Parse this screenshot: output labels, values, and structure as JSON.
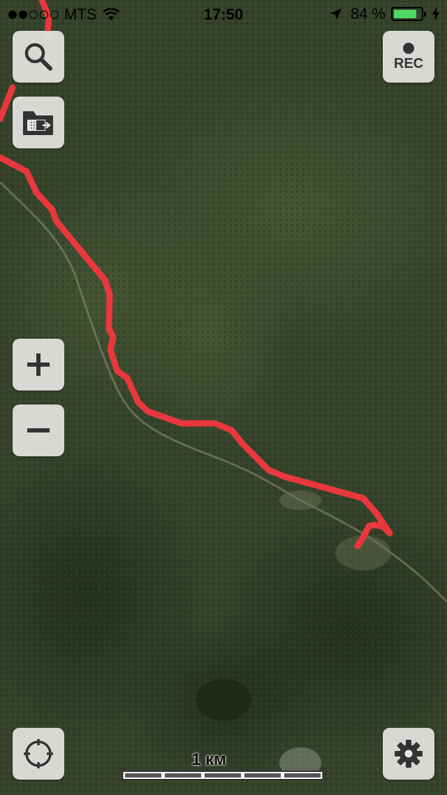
{
  "status_bar": {
    "carrier": "MTS",
    "signal_bars_filled": 2,
    "signal_bars_total": 5,
    "time": "17:50",
    "battery_percent": "84 %",
    "battery_level": 0.84,
    "icons": [
      "wifi-icon",
      "location-arrow-icon",
      "charging-bolt-icon"
    ]
  },
  "map": {
    "layer": "satellite",
    "track_color": "#e8383d"
  },
  "controls": {
    "rec_label": "REC",
    "zoom_in_label": "+",
    "zoom_out_label": "−",
    "icons": [
      "search-icon",
      "folder-import-icon",
      "rec-dot-icon",
      "locate-icon",
      "gear-icon"
    ]
  },
  "scale": {
    "label": "1 км"
  }
}
